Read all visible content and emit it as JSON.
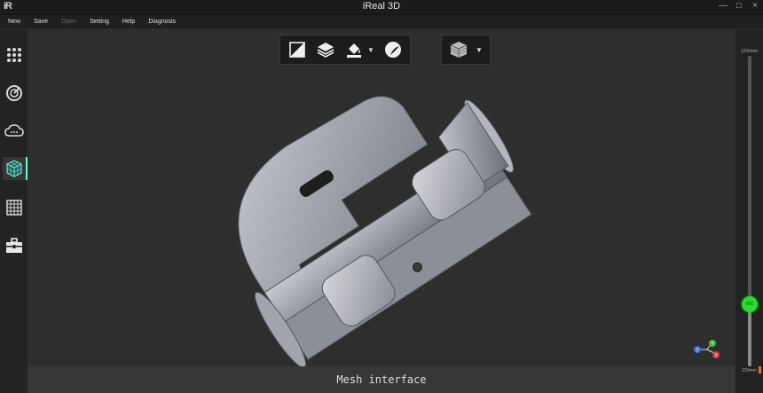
{
  "window": {
    "logo": "iR",
    "title": "iReal 3D",
    "controls": [
      "—",
      "□",
      "×"
    ]
  },
  "menu": [
    {
      "label": "New",
      "enabled": true
    },
    {
      "label": "Save",
      "enabled": true
    },
    {
      "label": "Open",
      "enabled": false
    },
    {
      "label": "Setting",
      "enabled": true
    },
    {
      "label": "Help",
      "enabled": true
    },
    {
      "label": "Diagnosis",
      "enabled": true
    }
  ],
  "sidebar": {
    "items": [
      {
        "icon": "grid-dots-icon"
      },
      {
        "icon": "scan-radar-icon"
      },
      {
        "icon": "cloud-icon"
      },
      {
        "icon": "mesh-cube-icon",
        "active": true
      },
      {
        "icon": "grid-table-icon"
      },
      {
        "icon": "toolbox-icon"
      }
    ]
  },
  "toolbar": {
    "group1": [
      "split-view-icon",
      "layers-icon",
      "fill-bucket-icon",
      "texture-sphere-icon"
    ],
    "group2": [
      "display-mode-icon"
    ]
  },
  "status": {
    "text": "Mesh interface"
  },
  "depth_slider": {
    "max_label": "1200mm",
    "min_label": "200mm",
    "value_label": "400",
    "value": 400,
    "min": 200,
    "max": 1200
  },
  "axis_gizmo": {
    "labels": [
      "Y",
      "X",
      "Z"
    ],
    "colors": {
      "x": "#e04040",
      "y": "#40c040",
      "z": "#4070e0"
    }
  }
}
